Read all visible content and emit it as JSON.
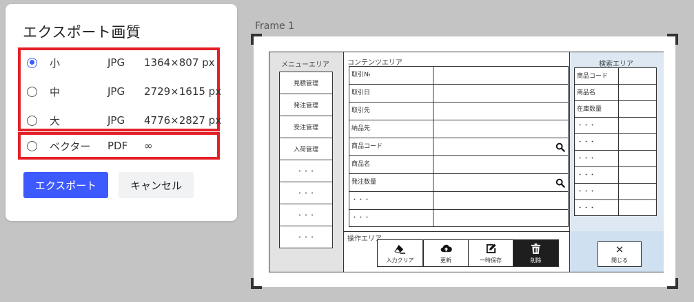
{
  "dialog": {
    "title": "エクスポート画質",
    "options": [
      {
        "size": "小",
        "format": "JPG",
        "dimensions": "1364×807 px",
        "selected": true
      },
      {
        "size": "中",
        "format": "JPG",
        "dimensions": "2729×1615 px",
        "selected": false
      },
      {
        "size": "大",
        "format": "JPG",
        "dimensions": "4776×2827 px",
        "selected": false
      },
      {
        "size": "ベクター",
        "format": "PDF",
        "dimensions": "∞",
        "selected": false
      }
    ],
    "export_label": "エクスポート",
    "cancel_label": "キャンセル",
    "accent_color": "#3d5afe",
    "highlight_color": "#e32027"
  },
  "frame": {
    "label": "Frame 1",
    "menu": {
      "title": "メニューエリア",
      "items": [
        "見積管理",
        "発注管理",
        "受注管理",
        "入荷管理",
        "・・・",
        "・・・",
        "・・・",
        "・・・"
      ]
    },
    "content": {
      "title": "コンテンツエリア",
      "rows": [
        {
          "label": "取引№",
          "search": false
        },
        {
          "label": "取引日",
          "search": false
        },
        {
          "label": "取引先",
          "search": false
        },
        {
          "label": "納品先",
          "search": false
        },
        {
          "label": "商品コード",
          "search": true
        },
        {
          "label": "商品名",
          "search": false
        },
        {
          "label": "発注数量",
          "search": true
        },
        {
          "label": "・・・",
          "search": false
        },
        {
          "label": "・・・",
          "search": false
        }
      ]
    },
    "search_area": {
      "title": "検索エリア",
      "rows": [
        "商品コード",
        "商品名",
        "在庫数量",
        "・・・",
        "・・・",
        "・・・",
        "・・・",
        "・・・",
        "・・・"
      ]
    },
    "operations": {
      "title": "操作エリア",
      "buttons": [
        {
          "label": "入力クリア",
          "icon": "eraser-icon"
        },
        {
          "label": "更新",
          "icon": "cloud-upload-icon"
        },
        {
          "label": "一時保存",
          "icon": "edit-icon"
        },
        {
          "label": "削除",
          "icon": "trash-icon"
        }
      ]
    },
    "close": {
      "label": "閉じる",
      "icon": "close-icon"
    }
  }
}
